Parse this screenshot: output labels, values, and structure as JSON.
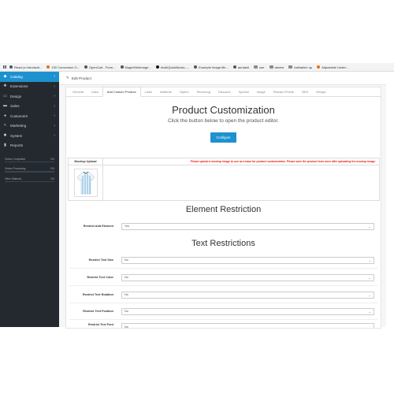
{
  "bookmarks": [
    {
      "label": "React js Introducti...",
      "icon": "page-icon",
      "color": "#555555"
    },
    {
      "label": "100 Conversion O...",
      "icon": "page-icon",
      "color": "#e8710a"
    },
    {
      "label": "OpenCart - Form...",
      "icon": "globe-icon",
      "color": "#555555"
    },
    {
      "label": "MagicWebimage...",
      "icon": "globe-icon",
      "color": "#555555"
    },
    {
      "label": "rAdd/QuickBooks -...",
      "icon": "github-icon",
      "color": "#111111"
    },
    {
      "label": "Example Image-file...",
      "icon": "globe-icon",
      "color": "#555555"
    },
    {
      "label": "aurdacti",
      "icon": "globe-icon",
      "color": "#555555"
    },
    {
      "label": "use",
      "icon": "folder-icon",
      "color": "#8a8a8a"
    },
    {
      "label": "abnew",
      "icon": "folder-icon",
      "color": "#8a8a8a"
    },
    {
      "label": "balhabtch up",
      "icon": "folder-icon",
      "color": "#8a8a8a"
    },
    {
      "label": "Adjustable Under...",
      "icon": "page-icon",
      "color": "#e8710a"
    }
  ],
  "sidebar": {
    "items": [
      {
        "label": "Catalog",
        "icon": "tag-icon",
        "glyph": "◆",
        "active": true
      },
      {
        "label": "Extensions",
        "icon": "puzzle-icon",
        "glyph": "✚",
        "active": false
      },
      {
        "label": "Design",
        "icon": "monitor-icon",
        "glyph": "▭",
        "active": false
      },
      {
        "label": "Sales",
        "icon": "cart-icon",
        "glyph": "▬",
        "active": false
      },
      {
        "label": "Customers",
        "icon": "user-icon",
        "glyph": "●",
        "active": false
      },
      {
        "label": "Marketing",
        "icon": "share-icon",
        "glyph": "<",
        "active": false
      },
      {
        "label": "System",
        "icon": "gear-icon",
        "glyph": "✱",
        "active": false
      },
      {
        "label": "Reports",
        "icon": "chart-icon",
        "glyph": "▮",
        "active": false
      }
    ],
    "progress": [
      {
        "label": "Orders Completed",
        "value": "0%",
        "fraction": 0
      },
      {
        "label": "Orders Processing",
        "value": "0%",
        "fraction": 0
      },
      {
        "label": "Other Statuses",
        "value": "0%",
        "fraction": 0
      }
    ]
  },
  "header": {
    "title": "Edit Product",
    "icon": "pencil-icon"
  },
  "tabs": [
    "General",
    "Data",
    "Add Custom Product",
    "Links",
    "Attribute",
    "Option",
    "Recurring",
    "Discount",
    "Special",
    "Image",
    "Reward Points",
    "SEO",
    "Design"
  ],
  "active_tab": "Add Custom Product",
  "customization": {
    "title": "Product Customization",
    "subtitle": "Click the button below to open the product editor.",
    "button": "Configure"
  },
  "mockup": {
    "header": "Mockup Upload",
    "message": "Please upload a mockup image to use as a base for product customization. Please save the product form once after uploading the mockup image."
  },
  "element_restriction": {
    "title": "Element Restriction",
    "rows": [
      {
        "label": "Restrict Add Element",
        "value": "Yes"
      }
    ]
  },
  "text_restrictions": {
    "title": "Text Restrictions",
    "rows": [
      {
        "label": "Restrict Text Size",
        "value": "No"
      },
      {
        "label": "Restrict Text Color",
        "value": "No"
      },
      {
        "label": "Restrict Text Rotation",
        "value": "No"
      },
      {
        "label": "Restrict Text Position",
        "value": "No"
      },
      {
        "label": "Restrict Text Font",
        "value": "No"
      }
    ]
  },
  "colors": {
    "accent": "#1e91cf",
    "sidebar": "#23292f",
    "warning": "#e8190c"
  }
}
